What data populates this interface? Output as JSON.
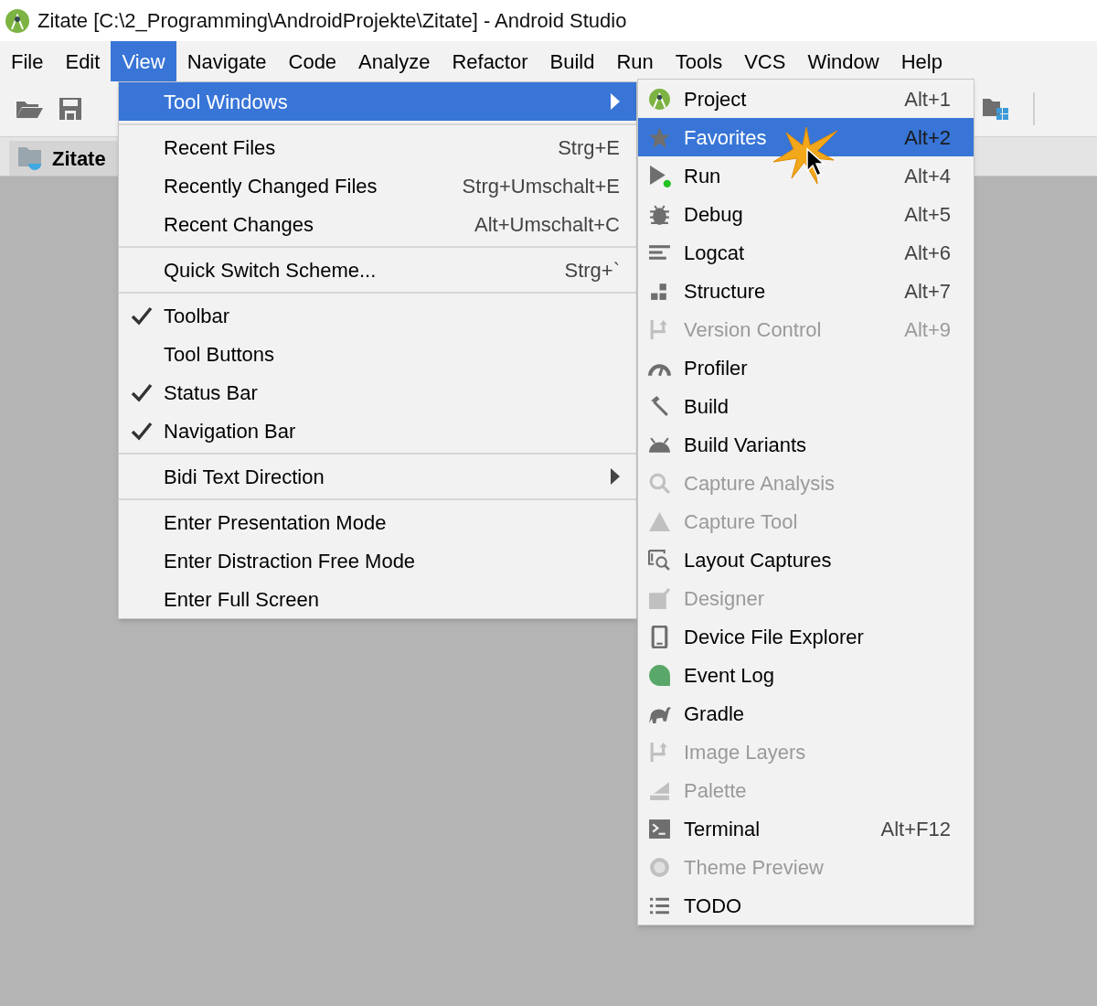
{
  "window": {
    "title": "Zitate [C:\\2_Programming\\AndroidProjekte\\Zitate] - Android Studio"
  },
  "menubar": [
    {
      "label": "File",
      "selected": false
    },
    {
      "label": "Edit",
      "selected": false
    },
    {
      "label": "View",
      "selected": true
    },
    {
      "label": "Navigate",
      "selected": false
    },
    {
      "label": "Code",
      "selected": false
    },
    {
      "label": "Analyze",
      "selected": false
    },
    {
      "label": "Refactor",
      "selected": false
    },
    {
      "label": "Build",
      "selected": false
    },
    {
      "label": "Run",
      "selected": false
    },
    {
      "label": "Tools",
      "selected": false
    },
    {
      "label": "VCS",
      "selected": false
    },
    {
      "label": "Window",
      "selected": false
    },
    {
      "label": "Help",
      "selected": false
    }
  ],
  "editor_tab": {
    "label": "Zitate"
  },
  "view_menu": [
    {
      "kind": "item",
      "label": "Tool Windows",
      "submenu": true,
      "checked": false,
      "selected": true
    },
    {
      "kind": "separator"
    },
    {
      "kind": "item",
      "label": "Recent Files",
      "shortcut": "Strg+E",
      "submenu": false,
      "checked": false,
      "selected": false
    },
    {
      "kind": "item",
      "label": "Recently Changed Files",
      "shortcut": "Strg+Umschalt+E",
      "submenu": false,
      "checked": false,
      "selected": false
    },
    {
      "kind": "item",
      "label": "Recent Changes",
      "shortcut": "Alt+Umschalt+C",
      "submenu": false,
      "checked": false,
      "selected": false
    },
    {
      "kind": "separator"
    },
    {
      "kind": "item",
      "label": "Quick Switch Scheme...",
      "shortcut": "Strg+`",
      "submenu": false,
      "checked": false,
      "selected": false
    },
    {
      "kind": "separator"
    },
    {
      "kind": "item",
      "label": "Toolbar",
      "submenu": false,
      "checked": true,
      "selected": false
    },
    {
      "kind": "item",
      "label": "Tool Buttons",
      "submenu": false,
      "checked": false,
      "selected": false
    },
    {
      "kind": "item",
      "label": "Status Bar",
      "submenu": false,
      "checked": true,
      "selected": false
    },
    {
      "kind": "item",
      "label": "Navigation Bar",
      "submenu": false,
      "checked": true,
      "selected": false
    },
    {
      "kind": "separator"
    },
    {
      "kind": "item",
      "label": "Bidi Text Direction",
      "submenu": true,
      "checked": false,
      "selected": false
    },
    {
      "kind": "separator"
    },
    {
      "kind": "item",
      "label": "Enter Presentation Mode",
      "submenu": false,
      "checked": false,
      "selected": false
    },
    {
      "kind": "item",
      "label": "Enter Distraction Free Mode",
      "submenu": false,
      "checked": false,
      "selected": false
    },
    {
      "kind": "item",
      "label": "Enter Full Screen",
      "submenu": false,
      "checked": false,
      "selected": false
    }
  ],
  "tool_windows_menu": [
    {
      "label": "Project",
      "shortcut": "Alt+1",
      "disabled": false,
      "selected": false
    },
    {
      "label": "Favorites",
      "shortcut": "Alt+2",
      "disabled": false,
      "selected": true
    },
    {
      "label": "Run",
      "shortcut": "Alt+4",
      "disabled": false,
      "selected": false
    },
    {
      "label": "Debug",
      "shortcut": "Alt+5",
      "disabled": false,
      "selected": false
    },
    {
      "label": "Logcat",
      "shortcut": "Alt+6",
      "disabled": false,
      "selected": false
    },
    {
      "label": "Structure",
      "shortcut": "Alt+7",
      "disabled": false,
      "selected": false
    },
    {
      "label": "Version Control",
      "shortcut": "Alt+9",
      "disabled": true,
      "selected": false
    },
    {
      "label": "Profiler",
      "disabled": false,
      "selected": false
    },
    {
      "label": "Build",
      "disabled": false,
      "selected": false
    },
    {
      "label": "Build Variants",
      "disabled": false,
      "selected": false
    },
    {
      "label": "Capture Analysis",
      "disabled": true,
      "selected": false
    },
    {
      "label": "Capture Tool",
      "disabled": true,
      "selected": false
    },
    {
      "label": "Layout Captures",
      "disabled": false,
      "selected": false
    },
    {
      "label": "Designer",
      "disabled": true,
      "selected": false
    },
    {
      "label": "Device File Explorer",
      "disabled": false,
      "selected": false
    },
    {
      "label": "Event Log",
      "disabled": false,
      "selected": false
    },
    {
      "label": "Gradle",
      "disabled": false,
      "selected": false
    },
    {
      "label": "Image Layers",
      "disabled": true,
      "selected": false
    },
    {
      "label": "Palette",
      "disabled": true,
      "selected": false
    },
    {
      "label": "Terminal",
      "shortcut": "Alt+F12",
      "disabled": false,
      "selected": false
    },
    {
      "label": "Theme Preview",
      "disabled": true,
      "selected": false
    },
    {
      "label": "TODO",
      "disabled": false,
      "selected": false
    }
  ]
}
